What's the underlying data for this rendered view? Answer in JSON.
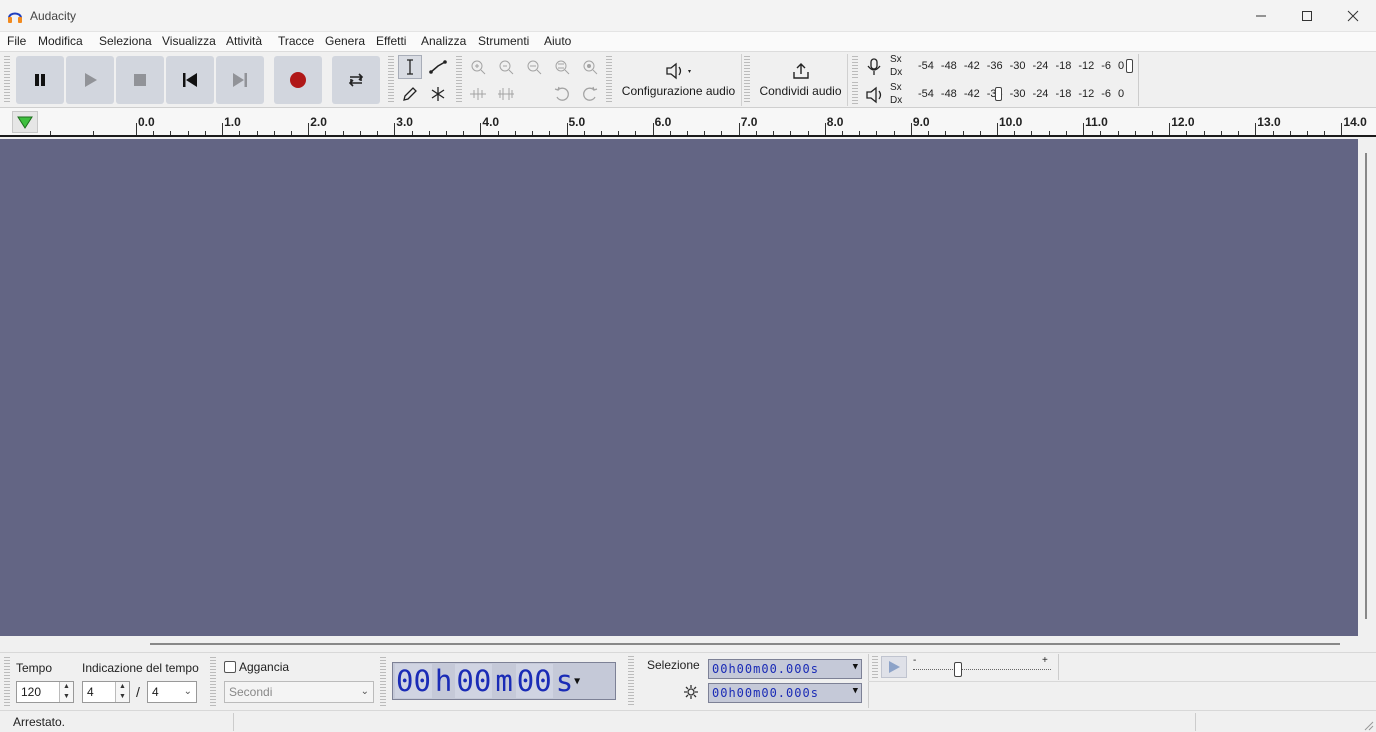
{
  "window": {
    "title": "Audacity"
  },
  "menu": [
    "File",
    "Modifica",
    "Seleziona",
    "Visualizza",
    "Attività",
    "Tracce",
    "Genera",
    "Effetti",
    "Analizza",
    "Strumenti",
    "Aiuto"
  ],
  "toolbar": {
    "audio_setup_label": "Configurazione audio",
    "share_audio_label": "Condividi audio"
  },
  "meters": {
    "record": {
      "left": "Sx",
      "right": "Dx",
      "scale": [
        "-54",
        "-48",
        "-42",
        "-36",
        "-30",
        "-24",
        "-18",
        "-12",
        "-6",
        "0"
      ]
    },
    "playback": {
      "left": "Sx",
      "right": "Dx",
      "scale": [
        "-54",
        "-48",
        "-42",
        "-36",
        "-30",
        "-24",
        "-18",
        "-12",
        "-6",
        "0"
      ]
    }
  },
  "timeline": {
    "ticks": [
      "0.0",
      "1.0",
      "2.0",
      "3.0",
      "4.0",
      "5.0",
      "6.0",
      "7.0",
      "8.0",
      "9.0",
      "10.0",
      "11.0",
      "12.0",
      "13.0",
      "14.0"
    ]
  },
  "bottom": {
    "tempo_label": "Tempo",
    "tempo_value": "120",
    "time_signature_label": "Indicazione del tempo",
    "time_sig_upper": "4",
    "time_sig_slash": "/",
    "time_sig_lower": "4",
    "snap_label": "Aggancia",
    "snap_unit": "Secondi",
    "big_time": {
      "h": "00",
      "hu": "h",
      "m": "00",
      "mu": "m",
      "s": "00",
      "su": "s"
    },
    "selection_label": "Selezione",
    "selection_start": "00h00m00.000s",
    "selection_end": "00h00m00.000s",
    "play_speed_min": "-",
    "play_speed_max": "+"
  },
  "status": {
    "text": "Arrestato."
  }
}
